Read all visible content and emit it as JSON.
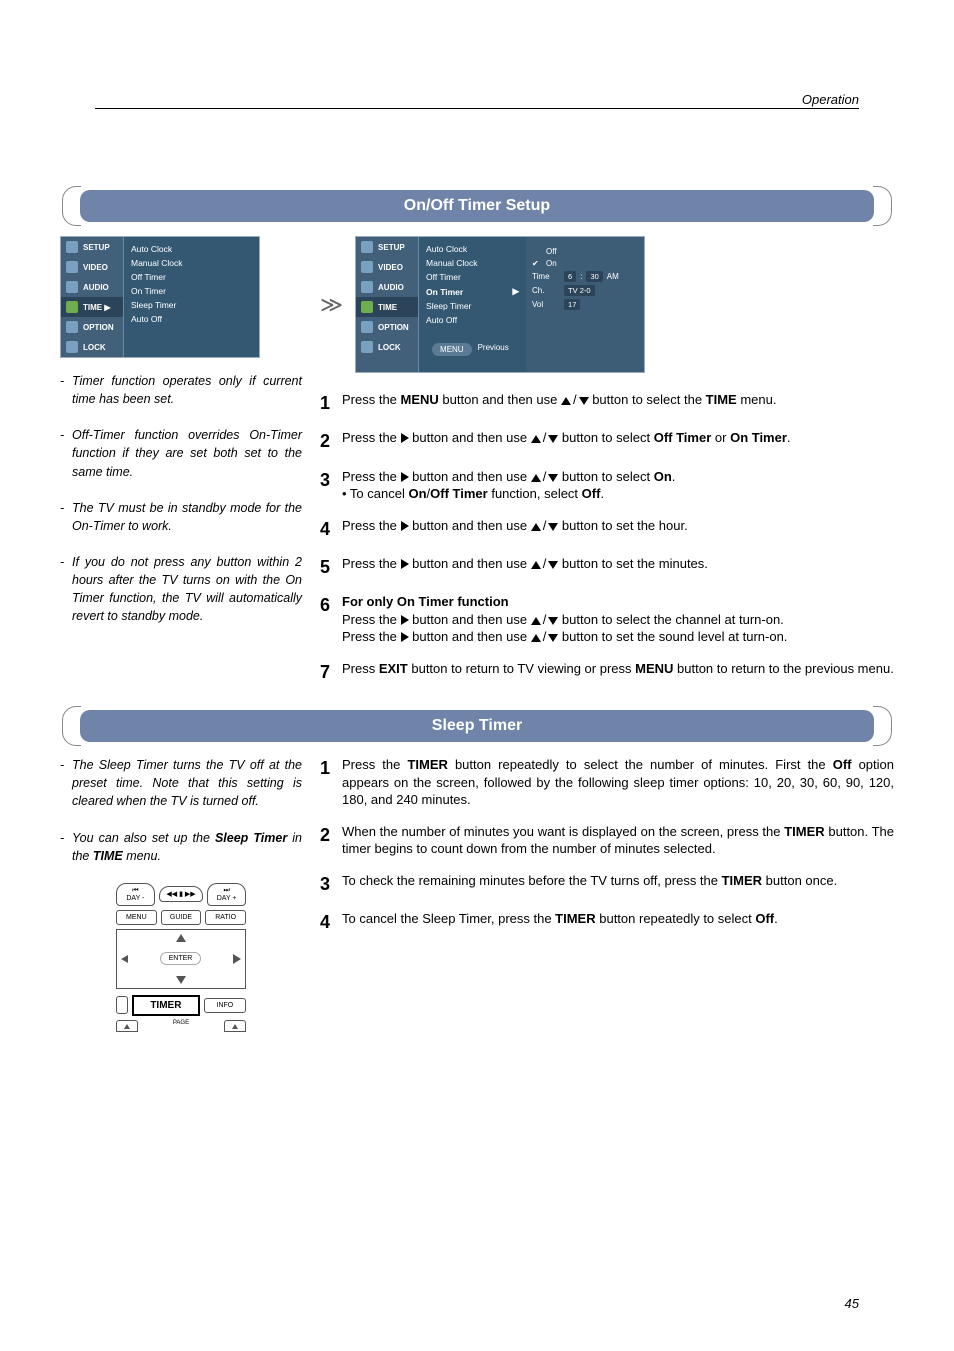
{
  "header": {
    "section": "Operation",
    "page": "45"
  },
  "section1": {
    "title": "On/Off Timer Setup",
    "menuLeft": {
      "side": [
        "SETUP",
        "VIDEO",
        "AUDIO",
        "TIME",
        "OPTION",
        "LOCK"
      ],
      "timeSel": "TIME ▶",
      "items": [
        "Auto Clock",
        "Manual Clock",
        "Off Timer",
        "On Timer",
        "Sleep Timer",
        "Auto Off"
      ]
    },
    "menuRight": {
      "side": [
        "SETUP",
        "VIDEO",
        "AUDIO",
        "TIME",
        "OPTION",
        "LOCK"
      ],
      "items": [
        "Auto Clock",
        "Manual Clock",
        "Off Timer",
        "On Timer",
        "Sleep Timer",
        "Auto Off"
      ],
      "selected": "On Timer",
      "detail": {
        "off": "Off",
        "on": "On",
        "timeLabel": "Time",
        "timeH": "6",
        "timeM": "30",
        "ampm": "AM",
        "chLabel": "Ch.",
        "chVal": "TV  2-0",
        "volLabel": "Vol",
        "volVal": "17"
      },
      "footer": {
        "menu": "MENU",
        "prev": "Previous"
      }
    },
    "notes": [
      "Timer function operates only if current time has been set.",
      "Off-Timer function overrides On-Timer function if they are set both set to the same time.",
      "The TV must be in standby mode for the On-Timer to work.",
      "If you do not press any button within 2 hours after the TV turns on with the On Timer function, the TV will automatically revert to standby mode."
    ],
    "steps": {
      "s1a": "Press the ",
      "s1b": "MENU",
      "s1c": " button and then use ",
      "s1d": " button to select the ",
      "s1e": "TIME",
      "s1f": " menu.",
      "s2a": "Press the ",
      "s2b": " button and then use ",
      "s2c": " button to select ",
      "s2d": "Off Timer",
      "s2e": " or ",
      "s2f": "On Timer",
      "s2g": ".",
      "s3a": "Press the ",
      "s3b": " button and then use ",
      "s3c": " button to select ",
      "s3d": "On",
      "s3e": ".",
      "s3f": "• To cancel ",
      "s3g": "On",
      "s3h": "/",
      "s3i": "Off Timer",
      "s3j": " function, select ",
      "s3k": "Off",
      "s3l": ".",
      "s4a": "Press the ",
      "s4b": " button and then use ",
      "s4c": " button to set the hour.",
      "s5a": "Press the ",
      "s5b": " button and then use ",
      "s5c": " button to set the minutes.",
      "s6title": "For only ",
      "s6title2": "On Timer",
      "s6title3": " function",
      "s6a": "Press the ",
      "s6b": " button and then use ",
      "s6c": " button to select the channel at turn-on.",
      "s6d": "Press the ",
      "s6e": " button and then use ",
      "s6f": " button to set the sound level at turn-on.",
      "s7a": "Press ",
      "s7b": "EXIT",
      "s7c": " button to return to TV viewing or press ",
      "s7d": "MENU",
      "s7e": " button to return to the previous menu."
    }
  },
  "section2": {
    "title": "Sleep Timer",
    "notes": [
      "The Sleep Timer turns the TV off at the preset time. Note that this setting is cleared when the TV is turned off."
    ],
    "note2a": "You can also set up the ",
    "note2b": "Sleep Timer",
    "note2c": " in the ",
    "note2d": "TIME",
    "note2e": " menu.",
    "remote": {
      "day1": "DAY -",
      "day2": "DAY +",
      "menu": "MENU",
      "guide": "GUIDE",
      "ratio": "RATIO",
      "enter": "ENTER",
      "timer": "TIMER",
      "info": "INFO",
      "page": "PAGE"
    },
    "steps": {
      "s1a": "Press the ",
      "s1b": "TIMER",
      "s1c": " button repeatedly to select the number of minutes. First the ",
      "s1d": "Off",
      "s1e": " option appears on the screen, followed by the following sleep timer options: 10, 20, 30, 60, 90, 120, 180, and 240 minutes.",
      "s2a": "When the number of minutes you want is displayed on the screen, press the ",
      "s2b": "TIMER",
      "s2c": " button. The timer begins to count down from the number of minutes selected.",
      "s3a": "To check the remaining minutes before the TV turns off, press the ",
      "s3b": "TIMER",
      "s3c": " button once.",
      "s4a": "To cancel the Sleep Timer, press the ",
      "s4b": "TIMER",
      "s4c": " button repeatedly to select ",
      "s4d": "Off",
      "s4e": "."
    }
  }
}
